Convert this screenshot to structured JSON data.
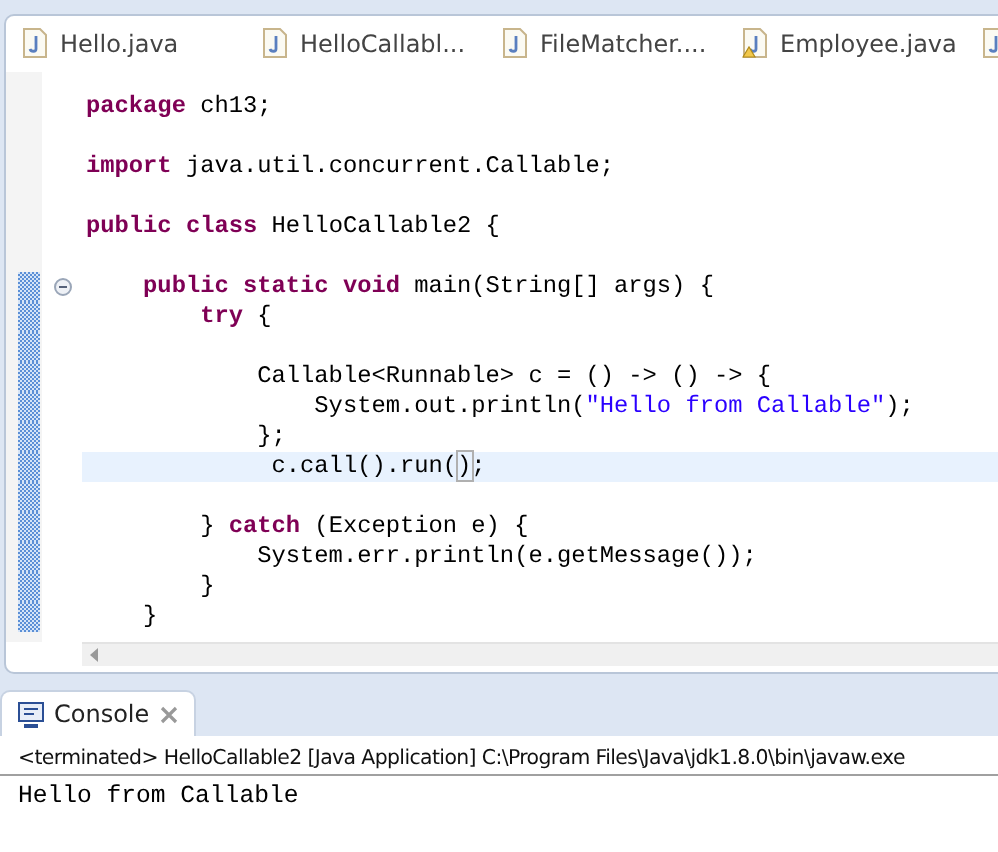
{
  "editor_tabs": [
    {
      "label": "Hello.java",
      "warning": false
    },
    {
      "label": "HelloCallabl...",
      "warning": false
    },
    {
      "label": "FileMatcher....",
      "warning": false
    },
    {
      "label": "Employee.java",
      "warning": true
    },
    {
      "warning": false
    }
  ],
  "code_lines": [
    {
      "changed": false,
      "current": false,
      "segments": [
        {
          "kind": "keyword",
          "text": "package"
        },
        {
          "kind": "plain",
          "text": " ch13;"
        }
      ]
    },
    {
      "changed": false,
      "current": false
    },
    {
      "changed": false,
      "current": false,
      "segments": [
        {
          "kind": "keyword",
          "text": "import"
        },
        {
          "kind": "plain",
          "text": " java.util.concurrent.Callable;"
        }
      ]
    },
    {
      "changed": false,
      "current": false
    },
    {
      "changed": false,
      "current": false,
      "segments": [
        {
          "kind": "keyword",
          "text": "public class"
        },
        {
          "kind": "plain",
          "text": " HelloCallable2 {"
        }
      ]
    },
    {
      "changed": false,
      "current": false
    },
    {
      "changed": true,
      "current": false,
      "expanded": true,
      "segments": [
        {
          "kind": "keyword",
          "text": "    public static void"
        },
        {
          "kind": "plain",
          "text": " main(String[] args) {"
        }
      ]
    },
    {
      "changed": true,
      "current": false,
      "segments": [
        {
          "kind": "keyword",
          "text": "        try"
        },
        {
          "kind": "plain",
          "text": " {"
        }
      ]
    },
    {
      "changed": true,
      "current": false
    },
    {
      "changed": true,
      "current": false,
      "segments": [
        {
          "kind": "plain",
          "text": "            Callable<Runnable> c = () -> () -> {"
        }
      ]
    },
    {
      "changed": true,
      "current": false,
      "segments": [
        {
          "kind": "plain",
          "text": "                System.out.println("
        },
        {
          "kind": "string",
          "text": "\"Hello from Callable\""
        },
        {
          "kind": "plain",
          "text": ");"
        }
      ]
    },
    {
      "changed": true,
      "current": false,
      "segments": [
        {
          "kind": "plain",
          "text": "            };"
        }
      ]
    },
    {
      "changed": true,
      "current": true,
      "segments": [
        {
          "kind": "plain",
          "text": "             c.call().run("
        },
        {
          "kind": "bracket",
          "text": ")"
        },
        {
          "kind": "plain",
          "text": ";"
        }
      ]
    },
    {
      "changed": true,
      "current": false
    },
    {
      "changed": true,
      "current": false,
      "segments": [
        {
          "kind": "plain",
          "text": "        } "
        },
        {
          "kind": "keyword",
          "text": "catch"
        },
        {
          "kind": "plain",
          "text": " (Exception e) {"
        }
      ]
    },
    {
      "changed": true,
      "current": false,
      "segments": [
        {
          "kind": "plain",
          "text": "            System.err.println(e.getMessage());"
        }
      ]
    },
    {
      "changed": true,
      "current": false,
      "segments": [
        {
          "kind": "plain",
          "text": "        }"
        }
      ]
    },
    {
      "changed": true,
      "current": false,
      "segments": [
        {
          "kind": "plain",
          "text": "    }"
        }
      ]
    }
  ],
  "console": {
    "tab_label": "Console",
    "status": "<terminated> HelloCallable2 [Java Application] C:\\Program Files\\Java\\jdk1.8.0\\bin\\javaw.exe",
    "output": "Hello from Callable"
  }
}
